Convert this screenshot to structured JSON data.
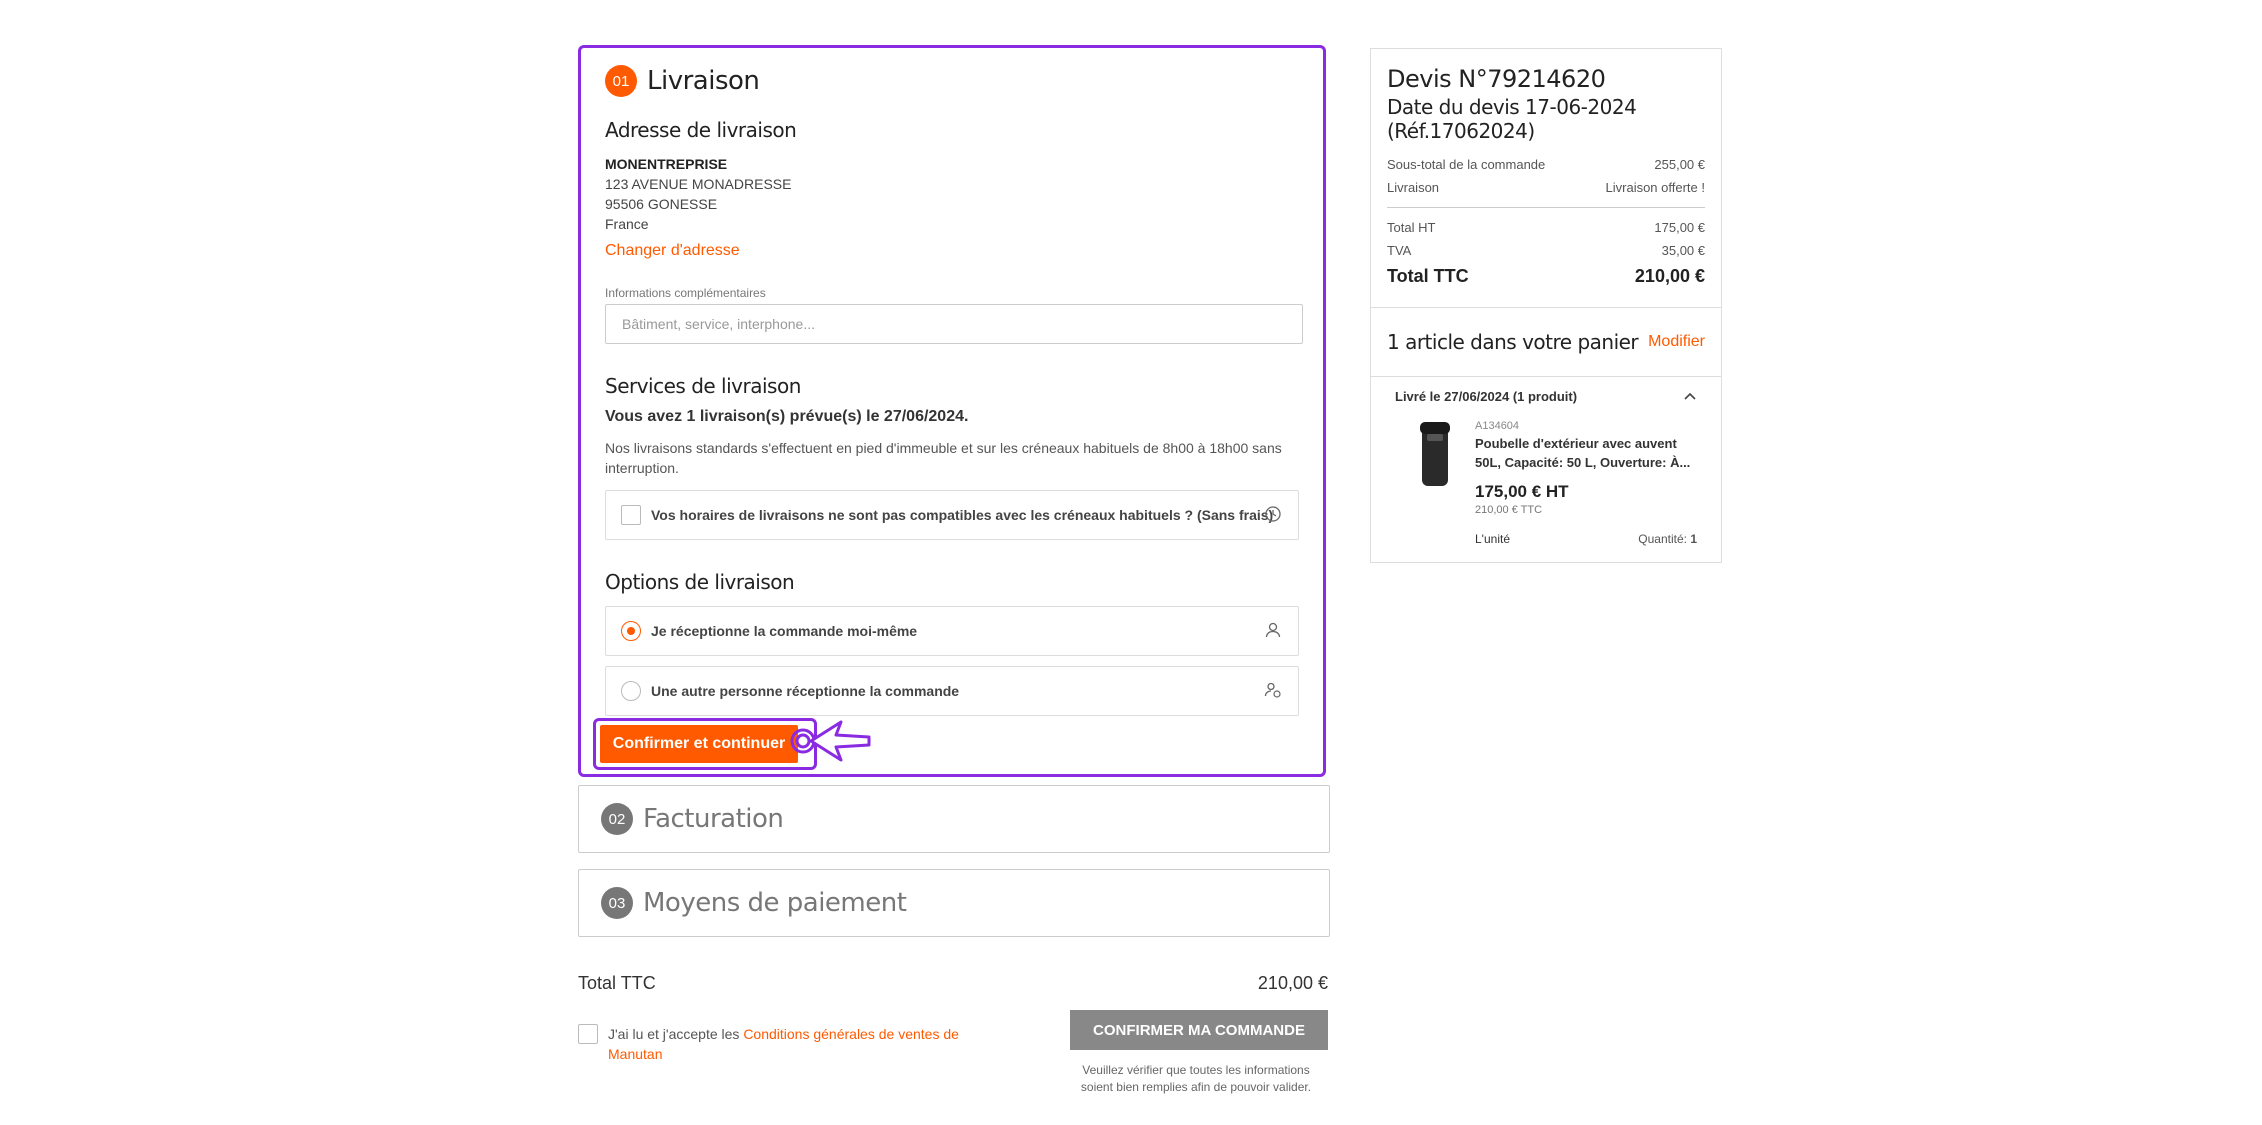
{
  "steps": {
    "livraison": {
      "num": "01",
      "title": "Livraison"
    },
    "facturation": {
      "num": "02",
      "title": "Facturation"
    },
    "paiement": {
      "num": "03",
      "title": "Moyens de paiement"
    }
  },
  "address": {
    "heading": "Adresse de livraison",
    "company": "MONENTREPRISE",
    "street": "123 AVENUE MONADRESSE",
    "city": "95506 GONESSE",
    "country": "France",
    "change_link": "Changer d'adresse"
  },
  "info": {
    "label": "Informations complémentaires",
    "placeholder": "Bâtiment, service, interphone..."
  },
  "services": {
    "heading": "Services de livraison",
    "summary": "Vous avez 1 livraison(s) prévue(s) le 27/06/2024.",
    "description": "Nos livraisons standards s'effectuent en pied d'immeuble et sur les créneaux habituels de 8h00 à 18h00 sans interruption.",
    "schedule_option": "Vos horaires de livraisons ne sont pas compatibles avec les créneaux habituels ? (Sans frais)"
  },
  "options": {
    "heading": "Options de livraison",
    "self": "Je réceptionne la commande moi-même",
    "other": "Une autre personne réceptionne la commande"
  },
  "confirm_button": "Confirmer et continuer",
  "order_total": {
    "label": "Total TTC",
    "value": "210,00 €"
  },
  "cgv": {
    "prefix": "J'ai lu et j'accepte les ",
    "link": "Conditions générales de ventes de Manutan"
  },
  "confirm_order": {
    "label": "CONFIRMER MA COMMANDE",
    "note": "Veuillez vérifier que toutes les informations soient bien remplies afin de pouvoir valider."
  },
  "summary": {
    "devis_no": "Devis N°79214620",
    "devis_date": "Date du devis 17-06-2024 (Réf.17062024)",
    "subtotal_label": "Sous-total de la commande",
    "subtotal": "255,00 €",
    "delivery_label": "Livraison",
    "delivery": "Livraison offerte !",
    "ht_label": "Total HT",
    "ht": "175,00 €",
    "tva_label": "TVA",
    "tva": "35,00 €",
    "ttc_label": "Total TTC",
    "ttc": "210,00 €"
  },
  "cart": {
    "title": "1 article dans votre panier",
    "modify": "Modifier",
    "delivery_group": "Livré le 27/06/2024 (1 produit)",
    "product": {
      "ref": "A134604",
      "name": "Poubelle d'extérieur avec auvent 50L, Capacité: 50 L, Ouverture: À...",
      "price": "175,00 €  HT",
      "price_ttc": "210,00 € TTC",
      "unit": "L'unité",
      "qty_label": "Quantité: ",
      "qty": "1"
    }
  },
  "colors": {
    "accent": "#ff5a00",
    "highlight": "#8a2be2",
    "disabled": "#888888"
  }
}
